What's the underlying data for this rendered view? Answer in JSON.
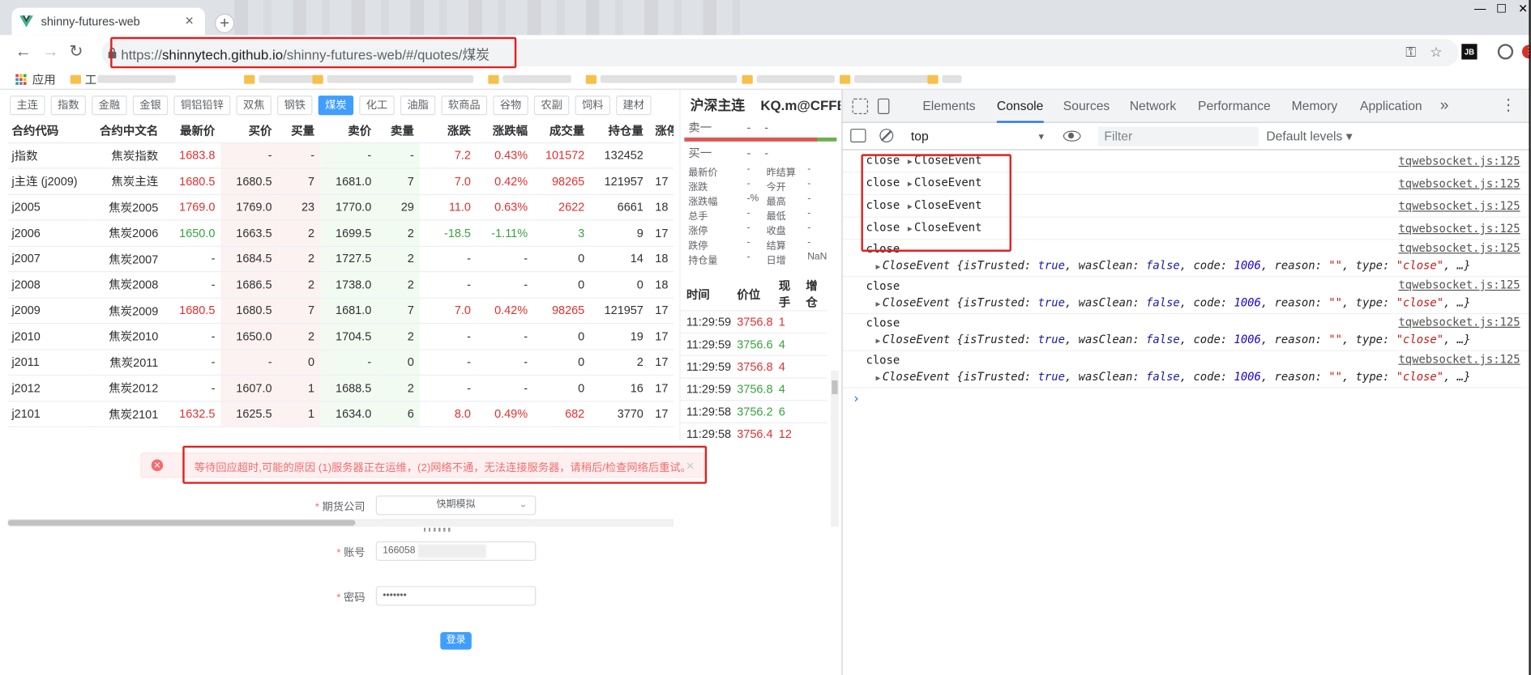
{
  "browser": {
    "tab_title": "shinny-futures-web",
    "tab_close": "×",
    "new_tab": "+",
    "window_controls": {
      "minimize": "—",
      "maximize": "☐",
      "close": "✕"
    },
    "nav": {
      "back": "←",
      "forward": "→",
      "reload": "↻"
    },
    "url_host": "shinnytech.github.io",
    "url_path": "/shinny-futures-web/#/quotes/煤炭",
    "url_scheme": "https://",
    "bookmarks": {
      "apps_label": "应用",
      "item2": "工"
    },
    "icons": {
      "key": "⚿",
      "star": "☆",
      "jb": "JB",
      "menu": "⋮"
    }
  },
  "categories": [
    "主连",
    "指数",
    "金融",
    "金银",
    "铜铝铅锌",
    "双焦",
    "钢铁",
    "煤炭",
    "化工",
    "油脂",
    "软商品",
    "谷物",
    "农副",
    "饲料",
    "建材"
  ],
  "active_category": "煤炭",
  "quotes": {
    "headers": [
      "合约代码",
      "合约中文名",
      "最新价",
      "买价",
      "买量",
      "卖价",
      "卖量",
      "涨跌",
      "涨跌幅",
      "成交量",
      "持仓量",
      "涨停"
    ],
    "rows": [
      {
        "code": "j指数",
        "name": "焦炭指数",
        "last": "1683.8",
        "bid": "-",
        "bidv": "-",
        "ask": "-",
        "askv": "-",
        "chg": "7.2",
        "pct": "0.43%",
        "vol": "101572",
        "oi": "132452",
        "lim": "",
        "dir": "up"
      },
      {
        "code": "j主连 (j2009)",
        "name": "焦炭主连",
        "last": "1680.5",
        "bid": "1680.5",
        "bidv": "7",
        "ask": "1681.0",
        "askv": "7",
        "chg": "7.0",
        "pct": "0.42%",
        "vol": "98265",
        "oi": "121957",
        "lim": "17",
        "dir": "up"
      },
      {
        "code": "j2005",
        "name": "焦炭2005",
        "last": "1769.0",
        "bid": "1769.0",
        "bidv": "23",
        "ask": "1770.0",
        "askv": "29",
        "chg": "11.0",
        "pct": "0.63%",
        "vol": "2622",
        "oi": "6661",
        "lim": "18",
        "dir": "up"
      },
      {
        "code": "j2006",
        "name": "焦炭2006",
        "last": "1650.0",
        "bid": "1663.5",
        "bidv": "2",
        "ask": "1699.5",
        "askv": "2",
        "chg": "-18.5",
        "pct": "-1.11%",
        "vol": "3",
        "oi": "9",
        "lim": "17",
        "dir": "down"
      },
      {
        "code": "j2007",
        "name": "焦炭2007",
        "last": "-",
        "bid": "1684.5",
        "bidv": "2",
        "ask": "1727.5",
        "askv": "2",
        "chg": "-",
        "pct": "-",
        "vol": "0",
        "oi": "14",
        "lim": "18",
        "dir": ""
      },
      {
        "code": "j2008",
        "name": "焦炭2008",
        "last": "-",
        "bid": "1686.5",
        "bidv": "2",
        "ask": "1738.0",
        "askv": "2",
        "chg": "-",
        "pct": "-",
        "vol": "0",
        "oi": "0",
        "lim": "18",
        "dir": ""
      },
      {
        "code": "j2009",
        "name": "焦炭2009",
        "last": "1680.5",
        "bid": "1680.5",
        "bidv": "7",
        "ask": "1681.0",
        "askv": "7",
        "chg": "7.0",
        "pct": "0.42%",
        "vol": "98265",
        "oi": "121957",
        "lim": "17",
        "dir": "up"
      },
      {
        "code": "j2010",
        "name": "焦炭2010",
        "last": "-",
        "bid": "1650.0",
        "bidv": "2",
        "ask": "1704.5",
        "askv": "2",
        "chg": "-",
        "pct": "-",
        "vol": "0",
        "oi": "19",
        "lim": "17",
        "dir": ""
      },
      {
        "code": "j2011",
        "name": "焦炭2011",
        "last": "-",
        "bid": "-",
        "bidv": "0",
        "ask": "-",
        "askv": "0",
        "chg": "-",
        "pct": "-",
        "vol": "0",
        "oi": "2",
        "lim": "17",
        "dir": ""
      },
      {
        "code": "j2012",
        "name": "焦炭2012",
        "last": "-",
        "bid": "1607.0",
        "bidv": "1",
        "ask": "1688.5",
        "askv": "2",
        "chg": "-",
        "pct": "-",
        "vol": "0",
        "oi": "16",
        "lim": "17",
        "dir": ""
      },
      {
        "code": "j2101",
        "name": "焦炭2101",
        "last": "1632.5",
        "bid": "1625.5",
        "bidv": "1",
        "ask": "1634.0",
        "askv": "6",
        "chg": "8.0",
        "pct": "0.49%",
        "vol": "682",
        "oi": "3770",
        "lim": "17",
        "dir": "up"
      }
    ]
  },
  "detail": {
    "name": "沪深主连",
    "symbol": "KQ.m@CFFE",
    "ask_label": "卖一",
    "bid_label": "买一",
    "dash": "-",
    "stats": [
      {
        "l": "最新价",
        "v": "-",
        "l2": "昨结算",
        "v2": "-"
      },
      {
        "l": "涨跌",
        "v": "-",
        "l2": "今开",
        "v2": "-"
      },
      {
        "l": "涨跌幅",
        "v": "-%",
        "l2": "最高",
        "v2": "-"
      },
      {
        "l": "总手",
        "v": "-",
        "l2": "最低",
        "v2": "-"
      },
      {
        "l": "涨停",
        "v": "-",
        "l2": "收盘",
        "v2": "-"
      },
      {
        "l": "跌停",
        "v": "-",
        "l2": "结算",
        "v2": "-"
      },
      {
        "l": "持仓量",
        "v": "-",
        "l2": "日增",
        "v2": "NaN"
      }
    ],
    "tick_headers": [
      "时间",
      "价位",
      "现手",
      "增仓"
    ],
    "ticks": [
      {
        "t": "11:29:59",
        "p": "3756.8",
        "v": "1",
        "dir": "up"
      },
      {
        "t": "11:29:59",
        "p": "3756.6",
        "v": "4",
        "dir": "down"
      },
      {
        "t": "11:29:59",
        "p": "3756.8",
        "v": "4",
        "dir": "up"
      },
      {
        "t": "11:29:59",
        "p": "3756.8",
        "v": "4",
        "dir": "down"
      },
      {
        "t": "11:29:58",
        "p": "3756.2",
        "v": "6",
        "dir": "down"
      },
      {
        "t": "11:29:58",
        "p": "3756.4",
        "v": "12",
        "dir": "up"
      }
    ]
  },
  "alert": {
    "text": "等待回应超时,可能的原因 (1)服务器正在运维，(2)网络不通，无法连接服务器，请稍后/检查网络后重试。",
    "icon": "✕",
    "close": "×"
  },
  "login": {
    "company_label": "期货公司",
    "company_value": "快期模拟",
    "account_label": "账号",
    "account_value": "166058",
    "password_label": "密码",
    "password_value": "•••••••",
    "submit": "登录",
    "required": "*",
    "chevron": "⌄"
  },
  "devtools": {
    "tabs": [
      "Elements",
      "Console",
      "Sources",
      "Network",
      "Performance",
      "Memory",
      "Application"
    ],
    "active_tab": "Console",
    "more": "»",
    "context": "top",
    "filter_placeholder": "Filter",
    "levels": "Default levels ▾",
    "source": "tqwebsocket.js:125",
    "short_logs": [
      {
        "msg": "close",
        "obj": "CloseEvent"
      },
      {
        "msg": "close",
        "obj": "CloseEvent"
      },
      {
        "msg": "close",
        "obj": "CloseEvent"
      },
      {
        "msg": "close",
        "obj": "CloseEvent"
      }
    ],
    "long_logs": [
      {
        "msg": "close"
      },
      {
        "msg": "close"
      },
      {
        "msg": "close"
      },
      {
        "msg": "close"
      }
    ],
    "event_parts": {
      "prefix": "CloseEvent {isTrusted: ",
      "is_trusted": "true",
      "was_clean_key": ", wasClean: ",
      "was_clean": "false",
      "code_key": ", code: ",
      "code": "1006",
      "reason_key": ", reason: ",
      "reason": "\"\"",
      "type_key": ", type: ",
      "type": "\"close\"",
      "suffix": ", …}"
    },
    "prompt": "›"
  }
}
